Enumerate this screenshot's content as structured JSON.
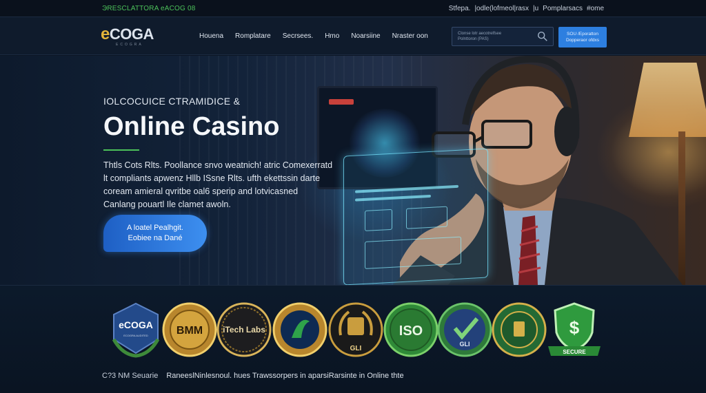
{
  "topbar": {
    "left_text": "ЭRESCLATTORA eACOG 08",
    "right_links": [
      "Stfepa.",
      "|odle(lofmeol|rasx",
      "|u",
      "Pomplarsacs",
      "#ome"
    ]
  },
  "header": {
    "logo": {
      "mark": "e",
      "word": "COGA",
      "sub": "ECOGRA"
    },
    "nav": [
      "Houena",
      "Romplatare",
      "Secrsees.",
      "Hmo",
      "Noarsiine",
      "Nraster oon"
    ],
    "search": {
      "placeholder_line1": "Clonse lotr aecotrelfsee",
      "placeholder_line2": "Polnttoron (PAS)",
      "icon": "search-icon"
    },
    "cta": {
      "line1": "SOU /Eporatton",
      "line2": "Dopperaor ofdxs"
    }
  },
  "hero": {
    "eyebrow": "IOLCOCUICE CTRAMIDICE &",
    "title": "Online Casino",
    "description_lines": [
      "Thtls Cots Rlts. Poollance snvo weatnich! atric Comexerratd",
      "lt compliants apwenz Hllb ISsne Rlts. ufth ekettssin darte",
      "coream amieral qvritbe oal6 sperip and lotvicasned",
      "Canlang pouartl Ile clamet awoln."
    ],
    "button": {
      "line1": "A loatel Pealhgit.",
      "line2": "Eobiee na Dané"
    },
    "accent_color": "#4cc25a"
  },
  "badges": [
    {
      "id": "ecoga",
      "label": "eCOGA",
      "sub": "ECOGRA AUDITED"
    },
    {
      "id": "bmm",
      "label": "BMM",
      "sub": ""
    },
    {
      "id": "itech",
      "label": "iTech Labs",
      "sub": ""
    },
    {
      "id": "green-seal",
      "label": "",
      "sub": ""
    },
    {
      "id": "gli-gold",
      "label": "GLI",
      "sub": ""
    },
    {
      "id": "iso",
      "label": "ISO",
      "sub": ""
    },
    {
      "id": "gli-check",
      "label": "GLI",
      "sub": ""
    },
    {
      "id": "green-emblem",
      "label": "",
      "sub": ""
    },
    {
      "id": "secure",
      "label": "SECURE",
      "sub": "$"
    }
  ],
  "footer": {
    "left": "C?3 NM Seuarie",
    "right": "RaneeslNinlesnoul. hues Trawssorpers in aparsiRarsinte in Online thte"
  }
}
